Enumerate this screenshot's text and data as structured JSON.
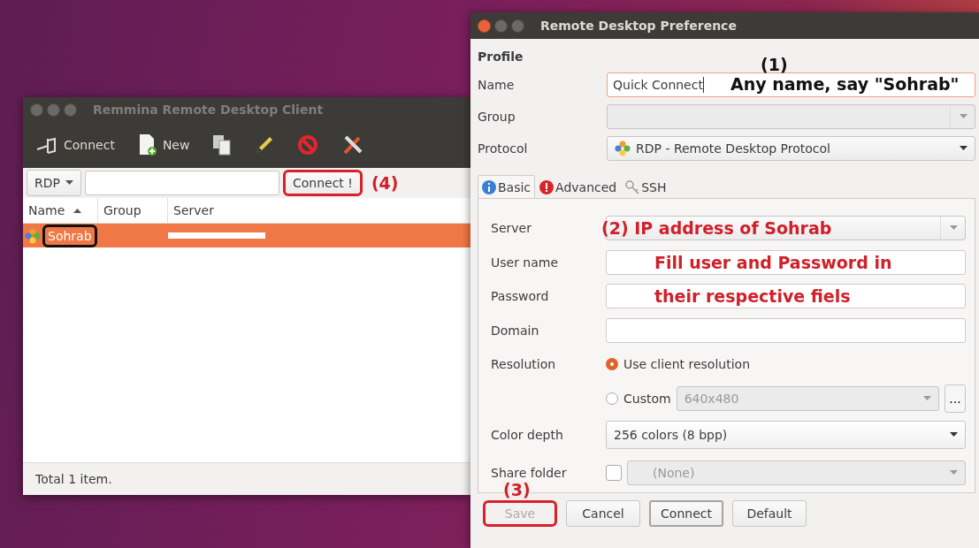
{
  "remmina": {
    "title": "Remmina Remote Desktop Client",
    "toolbar": [
      {
        "kind": "connect",
        "label": "Connect"
      },
      {
        "kind": "new",
        "label": "New"
      },
      {
        "kind": "copy"
      },
      {
        "kind": "edit"
      },
      {
        "kind": "delete"
      },
      {
        "kind": "tools"
      }
    ],
    "protocol": "RDP",
    "quick_connect": {
      "label": "Connect !",
      "color": "#d8202a"
    },
    "step_label": "(4)",
    "columns": [
      {
        "label": "Name",
        "sorted": true
      },
      {
        "label": "Group",
        "sorted": false
      },
      {
        "label": "Server",
        "sorted": false
      }
    ],
    "rows": [
      {
        "name": "Sohrab",
        "selected": true,
        "server_redacted": true,
        "color": "#111111"
      }
    ],
    "status": "Total 1 item."
  },
  "preference": {
    "title": "Remote Desktop Preference",
    "section": "Profile",
    "name": {
      "label": "Name",
      "value": "Quick Connect",
      "step_label": "(1)",
      "note": "Any name, say \"Sohrab\""
    },
    "group": {
      "label": "Group",
      "disabled": true
    },
    "protocol": {
      "label": "Protocol",
      "value": "RDP - Remote Desktop Protocol"
    },
    "tabs": [
      {
        "kind": "info",
        "label": "Basic",
        "selected": true
      },
      {
        "kind": "warning",
        "label": "Advanced",
        "selected": false
      },
      {
        "kind": "key",
        "label": "SSH",
        "selected": false
      }
    ],
    "server": {
      "label": "Server",
      "note": "(2)  IP address of Sohrab"
    },
    "user_name": {
      "label": "User name"
    },
    "password": {
      "label": "Password"
    },
    "credentials_note": [
      "Fill user and Password in",
      "their respective fiels"
    ],
    "domain": {
      "label": "Domain"
    },
    "resolution": {
      "label": "Resolution",
      "options": [
        {
          "label": "Use client resolution",
          "selected": true
        },
        {
          "label": "Custom",
          "selected": false
        }
      ],
      "custom_value": "640x480",
      "more_button": "..."
    },
    "color_depth": {
      "label": "Color depth",
      "value": "256 colors (8 bpp)"
    },
    "share_folder": {
      "label": "Share folder",
      "checked": false,
      "value": "(None)"
    },
    "step_label": "(3)",
    "buttons": [
      {
        "label": "Save",
        "disabled": true,
        "default": false,
        "color": "#d8202a"
      },
      {
        "label": "Cancel",
        "disabled": false,
        "default": false
      },
      {
        "label": "Connect",
        "disabled": false,
        "default": true
      },
      {
        "label": "Default",
        "disabled": false,
        "default": false
      }
    ]
  }
}
